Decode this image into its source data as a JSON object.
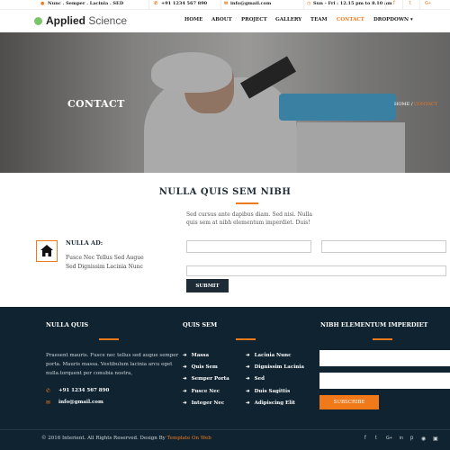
{
  "topbar": {
    "breadcrumb": "Nunc . Semper . Lacinia . SED",
    "phone": "+91 1234 567 890",
    "email": "info@gmail.com",
    "hours": "Sun - Fri : 12.15 pm to 8.10 am",
    "social_icons": [
      "facebook-icon",
      "twitter-icon",
      "google-plus-icon"
    ]
  },
  "brand": {
    "name_bold": "Applied",
    "name_rest": " Science"
  },
  "nav": {
    "items": [
      "HOME",
      "ABOUT",
      "PROJECT",
      "GALLERY",
      "TEAM",
      "CONTACT",
      "DROPDOWN"
    ],
    "active": "CONTACT"
  },
  "hero": {
    "title": "CONTACT",
    "crumb_home": "HOME",
    "crumb_sep": "/",
    "crumb_current": "CONTACT"
  },
  "section": {
    "title": "NULLA QUIS SEM NIBH",
    "intro": "Sed cursus ante dapibus diam. Sed nisi. Nulla quis sem at nibh elementum imperdiet. Duis!"
  },
  "address": {
    "heading": "NULLA AD:",
    "line1": "Fusce Nec Tellus Sed Augue",
    "line2": "Sed Dignissim Lacinia Nunc"
  },
  "form": {
    "submit_label": "SUBMIT"
  },
  "colors": {
    "accent": "#f07a1a",
    "dark": "#0f2430",
    "navy": "#1d2b36"
  },
  "footer": {
    "col1": {
      "heading": "NULLA QUIS",
      "text": "Praesent mauris. Fusce nec tellus sed augue semper porta. Mauris massa. Vestibulum lacinia arcu eget nulla.torquent per conubia nostra,",
      "phone": "+91 1234 567 890",
      "email": "info@gmail.com"
    },
    "col2": {
      "heading": "QUIS SEM",
      "links_left": [
        "Massa",
        "Quis Sem",
        "Semper Porta",
        "Fusce Nec",
        "Integer Nec"
      ],
      "links_right": [
        "Lacinia Nunc",
        "Dignissim Lacinia",
        "Sed",
        "Duis Sagittis",
        "Adipiscing Elit"
      ]
    },
    "col3": {
      "heading": "NIBH ELEMENTUM IMPERDIET",
      "subscribe_label": "SUBSCRIBE"
    },
    "copyright": "© 2016 Interient. All Rights Reserved. Design By ",
    "copyright_link": "Template On Web",
    "social_icons": [
      "facebook-icon",
      "twitter-icon",
      "google-plus-icon",
      "linkedin-icon",
      "pinterest-icon",
      "rss-icon",
      "instagram-icon"
    ]
  }
}
